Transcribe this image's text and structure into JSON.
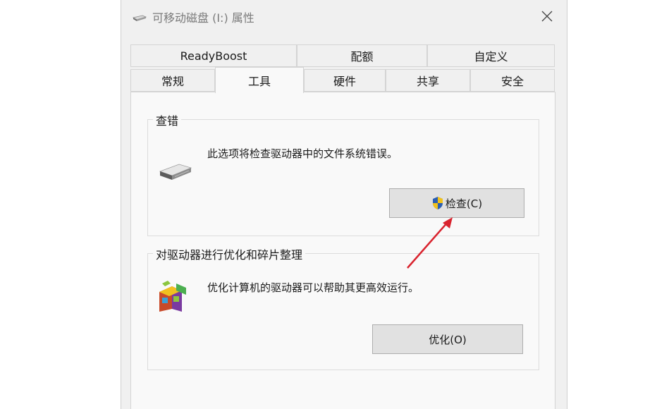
{
  "window": {
    "title": "可移动磁盘 (I:) 属性"
  },
  "tabs_row1": [
    {
      "label": "ReadyBoost"
    },
    {
      "label": "配额"
    },
    {
      "label": "自定义"
    }
  ],
  "tabs_row2": [
    {
      "label": "常规"
    },
    {
      "label": "工具",
      "active": true
    },
    {
      "label": "硬件"
    },
    {
      "label": "共享"
    },
    {
      "label": "安全"
    }
  ],
  "error_check": {
    "group_title": "查错",
    "description": "此选项将检查驱动器中的文件系统错误。",
    "button_label": "检查(C)",
    "icon": "drive-icon"
  },
  "optimize": {
    "group_title": "对驱动器进行优化和碎片整理",
    "description": "优化计算机的驱动器可以帮助其更高效运行。",
    "button_label": "优化(O)",
    "icon": "defrag-icon"
  },
  "annotation": {
    "arrow_color": "#d9232e"
  }
}
